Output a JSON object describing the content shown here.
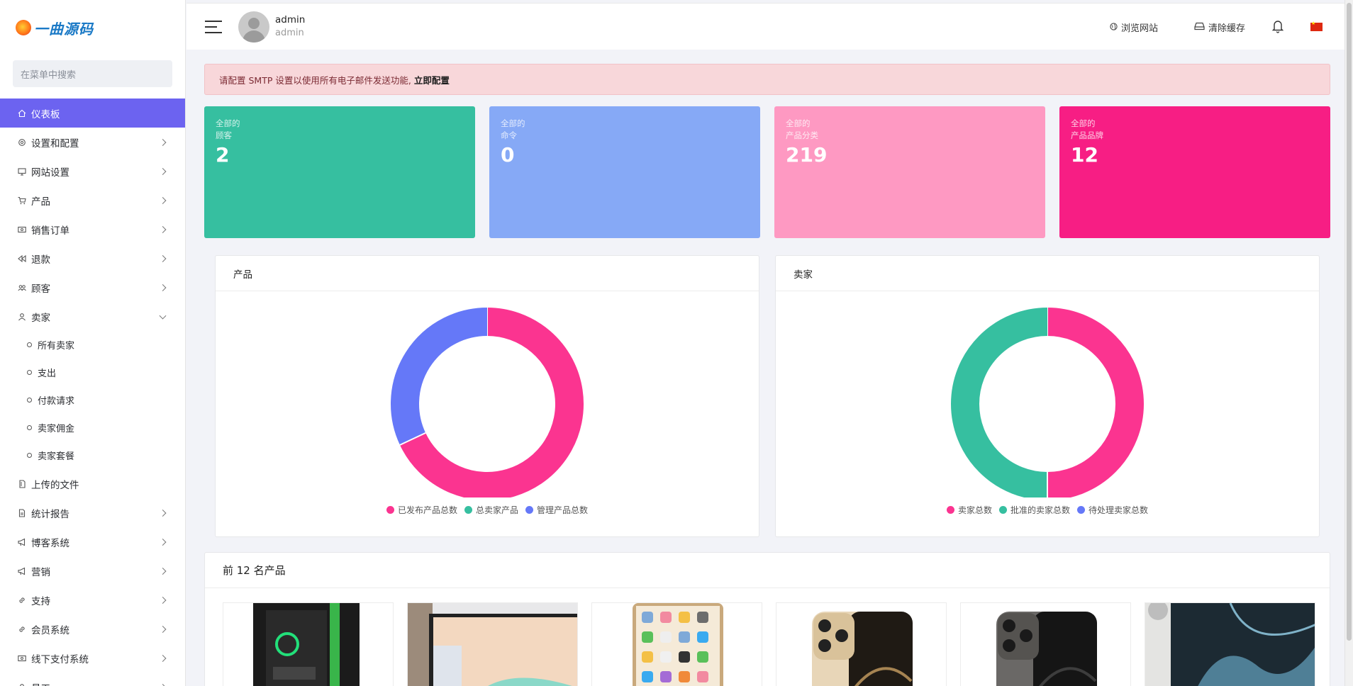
{
  "logo": {
    "text": "一曲源码"
  },
  "sidebar": {
    "search_placeholder": "在菜单中搜索",
    "items": [
      {
        "label": "仪表板",
        "icon": "home-icon",
        "active": true
      },
      {
        "label": "设置和配置",
        "icon": "gear-icon",
        "chevron": "right"
      },
      {
        "label": "网站设置",
        "icon": "monitor-icon",
        "chevron": "right"
      },
      {
        "label": "产品",
        "icon": "cart-icon",
        "chevron": "right"
      },
      {
        "label": "销售订单",
        "icon": "money-icon",
        "chevron": "right"
      },
      {
        "label": "退款",
        "icon": "rewind-icon",
        "chevron": "right"
      },
      {
        "label": "顾客",
        "icon": "users-icon",
        "chevron": "right"
      },
      {
        "label": "卖家",
        "icon": "user-icon",
        "chevron": "down"
      }
    ],
    "sub_items": [
      "所有卖家",
      "支出",
      "付款请求",
      "卖家佣金",
      "卖家套餐"
    ],
    "items_after": [
      {
        "label": "上传的文件",
        "icon": "file-icon"
      },
      {
        "label": "统计报告",
        "icon": "report-icon",
        "chevron": "right"
      },
      {
        "label": "博客系统",
        "icon": "megaphone-icon",
        "chevron": "right"
      },
      {
        "label": "营销",
        "icon": "megaphone-icon",
        "chevron": "right"
      },
      {
        "label": "支持",
        "icon": "link-icon",
        "chevron": "right"
      },
      {
        "label": "会员系统",
        "icon": "link-icon",
        "chevron": "right"
      },
      {
        "label": "线下支付系统",
        "icon": "money-icon",
        "chevron": "right"
      },
      {
        "label": "员工",
        "icon": "user-icon",
        "chevron": "right"
      }
    ]
  },
  "topbar": {
    "user_name": "admin",
    "user_role": "admin",
    "browse_site": "浏览网站",
    "clear_cache": "清除缓存"
  },
  "alert": {
    "message": "请配置 SMTP 设置以使用所有电子邮件发送功能,",
    "action": "立即配置"
  },
  "stats": [
    {
      "line1": "全部的",
      "line2": "顾客",
      "value": "2",
      "color": "#36bfa0"
    },
    {
      "line1": "全部的",
      "line2": "命令",
      "value": "0",
      "color": "#86a9f6"
    },
    {
      "line1": "全部的",
      "line2": "产品分类",
      "value": "219",
      "color": "#fe99c2"
    },
    {
      "line1": "全部的",
      "line2": "产品品牌",
      "value": "12",
      "color": "#f71e84"
    }
  ],
  "charts": {
    "products": {
      "title": "产品",
      "legend": [
        {
          "label": "已发布产品总数",
          "color": "#fb3490"
        },
        {
          "label": "总卖家产品",
          "color": "#36bfa0"
        },
        {
          "label": "管理产品总数",
          "color": "#6578f8"
        }
      ]
    },
    "sellers": {
      "title": "卖家",
      "legend": [
        {
          "label": "卖家总数",
          "color": "#fb3490"
        },
        {
          "label": "批准的卖家总数",
          "color": "#36bfa0"
        },
        {
          "label": "待处理卖家总数",
          "color": "#6578f8"
        }
      ]
    }
  },
  "chart_data": [
    {
      "type": "pie",
      "categories": [
        "已发布产品总数",
        "总卖家产品",
        "管理产品总数"
      ],
      "values": [
        68,
        0,
        32
      ]
    },
    {
      "type": "pie",
      "categories": [
        "卖家总数",
        "批准的卖家总数",
        "待处理卖家总数"
      ],
      "values": [
        50,
        50,
        0
      ]
    }
  ],
  "top_products": {
    "title": "前 12 名产品",
    "items": [
      {
        "name": "gaming-pc"
      },
      {
        "name": "monitor"
      },
      {
        "name": "iphone-home-screen"
      },
      {
        "name": "iphone-12-pro-gold"
      },
      {
        "name": "iphone-12-pro-graphite"
      },
      {
        "name": "iphone-11-pro"
      }
    ]
  }
}
